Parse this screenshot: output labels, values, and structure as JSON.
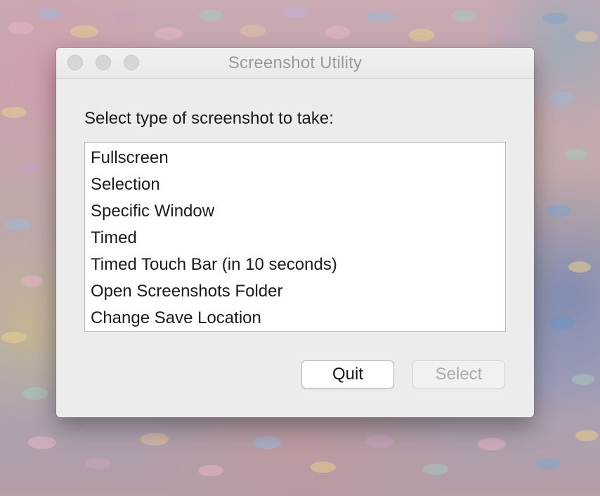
{
  "window": {
    "title": "Screenshot Utility"
  },
  "dialog": {
    "prompt": "Select type of screenshot to take:",
    "options": [
      "Fullscreen",
      "Selection",
      "Specific Window",
      "Timed",
      "Timed Touch Bar (in 10 seconds)",
      "Open Screenshots Folder",
      "Change Save Location"
    ],
    "quit_label": "Quit",
    "select_label": "Select",
    "select_enabled": false
  },
  "colors": {
    "window_background": "#ececec",
    "disabled_text": "#acacac",
    "title_text": "#9a9a9a"
  }
}
